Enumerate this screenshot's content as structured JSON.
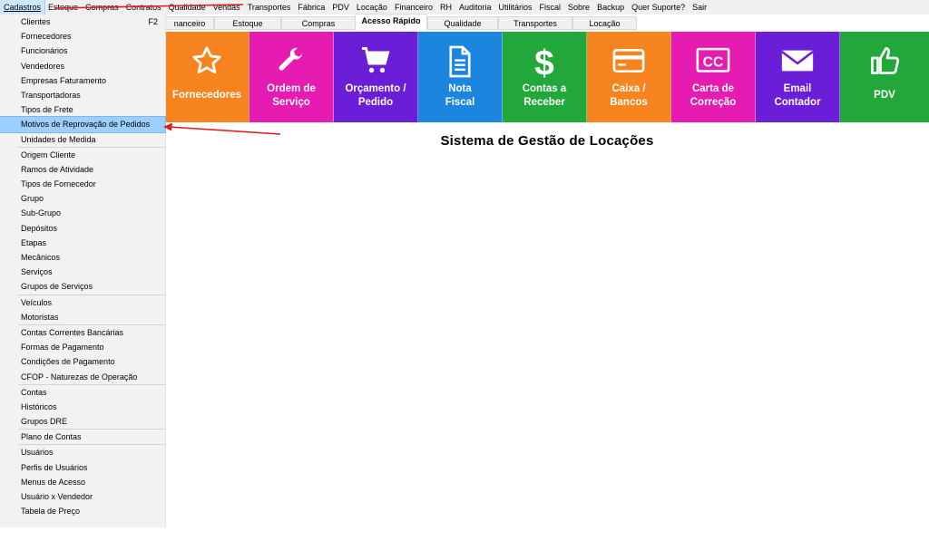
{
  "menubar": {
    "items": [
      "Cadastros",
      "Estoque",
      "Compras",
      "Contratos",
      "Qualidade",
      "Vendas",
      "Transportes",
      "Fábrica",
      "PDV",
      "Locação",
      "Financeiro",
      "RH",
      "Auditoria",
      "Utilitários",
      "Fiscal",
      "Sobre",
      "Backup",
      "Quer Suporte?",
      "Sair"
    ]
  },
  "tabs": [
    "nanceiro",
    "Estoque",
    "Compras",
    "Acesso Rápido",
    "Qualidade",
    "Transportes",
    "Locação"
  ],
  "tiles": [
    {
      "label": "Fornecedores",
      "color": "#f7841e",
      "icon": "star-icon"
    },
    {
      "label": "Ordem de\nServiço",
      "color": "#e61bb1",
      "icon": "wrench-icon"
    },
    {
      "label": "Orçamento /\nPedido",
      "color": "#6b1ed8",
      "icon": "cart-icon"
    },
    {
      "label": "Nota\nFiscal",
      "color": "#1c85e0",
      "icon": "document-icon"
    },
    {
      "label": "Contas a\nReceber",
      "color": "#22a83a",
      "icon": "dollar-icon"
    },
    {
      "label": "Caixa /\nBancos",
      "color": "#f7841e",
      "icon": "card-icon"
    },
    {
      "label": "Carta de\nCorreção",
      "color": "#e61bb1",
      "icon": "cc-icon"
    },
    {
      "label": "Email\nContador",
      "color": "#6b1ed8",
      "icon": "mail-icon"
    },
    {
      "label": "PDV",
      "color": "#22a83a",
      "icon": "thumbs-up-icon"
    }
  ],
  "title": "Sistema de Gestão de Locações",
  "dropdown": {
    "items": [
      {
        "label": "Clientes",
        "shortcut": "F2"
      },
      {
        "label": "Fornecedores"
      },
      {
        "label": "Funcionários"
      },
      {
        "label": "Vendedores"
      },
      {
        "label": "Empresas Faturamento"
      },
      {
        "label": "Transportadoras"
      },
      {
        "label": "Tipos de Frete"
      },
      {
        "label": "Motivos de Reprovação de Pedidos",
        "highlight": true
      },
      {
        "label": "Unidades de Medida"
      },
      {
        "label": "Origem Cliente"
      },
      {
        "label": "Ramos de Atividade"
      },
      {
        "label": "Tipos de Fornecedor"
      },
      {
        "label": "Grupo"
      },
      {
        "label": "Sub-Grupo"
      },
      {
        "label": "Depósitos"
      },
      {
        "label": "Etapas"
      },
      {
        "label": "Mecânicos"
      },
      {
        "label": "Serviços"
      },
      {
        "label": "Grupos de Serviços"
      },
      {
        "label": "Veículos"
      },
      {
        "label": "Motoristas"
      },
      {
        "label": "Contas Correntes Bancárias"
      },
      {
        "label": "Formas de Pagamento"
      },
      {
        "label": "Condições de Pagamento"
      },
      {
        "label": "CFOP - Naturezas de Operação"
      },
      {
        "label": "Contas"
      },
      {
        "label": "Históricos"
      },
      {
        "label": "Grupos DRE"
      },
      {
        "label": "Plano de Contas"
      },
      {
        "label": "Usuários"
      },
      {
        "label": "Perfis de Usuários"
      },
      {
        "label": "Menus de Acesso"
      },
      {
        "label": "Usuário x Vendedor"
      },
      {
        "label": "Tabela de Preço"
      }
    ]
  },
  "colors": {
    "highlight": "#9ccffb",
    "annotation": "#e02020"
  }
}
